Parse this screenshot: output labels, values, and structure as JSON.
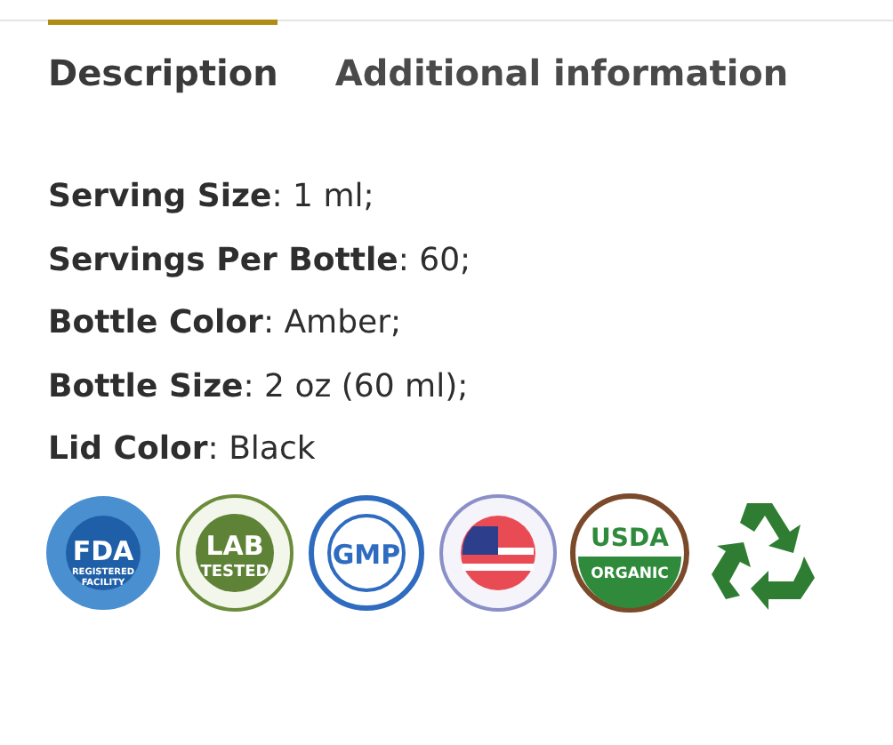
{
  "tabs": [
    {
      "label": "Description",
      "selected": true
    },
    {
      "label": "Additional information",
      "selected": false
    }
  ],
  "specs": [
    {
      "label": "Serving Size",
      "value": ": 1 ml;"
    },
    {
      "label": "Servings Per Bottle",
      "value": ": 60;"
    },
    {
      "label": "Bottle Color",
      "value": ": Amber;"
    },
    {
      "label": "Bottle Size",
      "value": ": 2 oz (60 ml);"
    },
    {
      "label": "Lid Color",
      "value": ": Black"
    }
  ],
  "badges": [
    {
      "kind": "fda",
      "texts": [
        "FDA",
        "REGISTERED",
        "FACILITY"
      ]
    },
    {
      "kind": "lab",
      "texts": [
        "LAB",
        "TESTED"
      ]
    },
    {
      "kind": "gmp",
      "texts": [
        "GMP"
      ]
    },
    {
      "kind": "usa"
    },
    {
      "kind": "usda",
      "texts": [
        "USDA",
        "ORGANIC"
      ]
    },
    {
      "kind": "recycle"
    }
  ]
}
